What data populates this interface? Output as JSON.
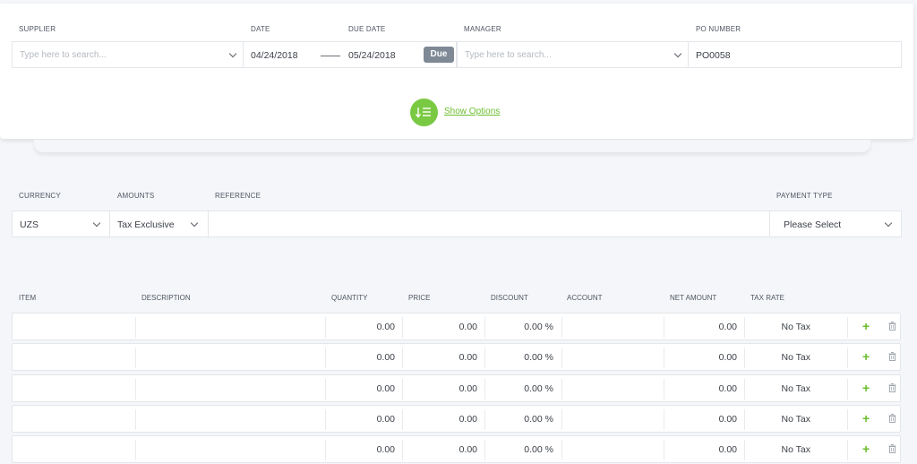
{
  "header": {
    "supplier_label": "SUPPLIER",
    "supplier_placeholder": "Type here to search...",
    "date_label": "DATE",
    "date_value": "04/24/2018",
    "due_date_label": "DUE DATE",
    "due_date_value": "05/24/2018",
    "due_badge": "Due",
    "manager_label": "MANAGER",
    "manager_placeholder": "Type here to search...",
    "po_label": "PO NUMBER",
    "po_value": "PO0058",
    "show_options": "Show Options"
  },
  "settings": {
    "currency_label": "CURRENCY",
    "currency_value": "UZS",
    "amounts_label": "AMOUNTS",
    "amounts_value": "Tax Exclusive",
    "reference_label": "REFERENCE",
    "reference_value": "",
    "payment_type_label": "PAYMENT TYPE",
    "payment_type_value": "Please Select"
  },
  "table": {
    "columns": {
      "item": "ITEM",
      "description": "DESCRIPTION",
      "quantity": "QUANTITY",
      "price": "PRICE",
      "discount": "DISCOUNT",
      "account": "ACCOUNT",
      "net_amount": "NET AMOUNT",
      "tax_rate": "TAX RATE"
    },
    "rows": [
      {
        "quantity": "0.00",
        "price": "0.00",
        "discount": "0.00 %",
        "net_amount": "0.00",
        "tax_rate": "No Tax"
      },
      {
        "quantity": "0.00",
        "price": "0.00",
        "discount": "0.00 %",
        "net_amount": "0.00",
        "tax_rate": "No Tax"
      },
      {
        "quantity": "0.00",
        "price": "0.00",
        "discount": "0.00 %",
        "net_amount": "0.00",
        "tax_rate": "No Tax"
      },
      {
        "quantity": "0.00",
        "price": "0.00",
        "discount": "0.00 %",
        "net_amount": "0.00",
        "tax_rate": "No Tax"
      },
      {
        "quantity": "0.00",
        "price": "0.00",
        "discount": "0.00 %",
        "net_amount": "0.00",
        "tax_rate": "No Tax"
      }
    ],
    "add_glyph": "+"
  },
  "colors": {
    "accent": "#7ac943",
    "link": "#6bbd2e",
    "badge": "#7f8895"
  },
  "icons": {
    "dropdown": "chevron-down-icon",
    "options": "sort-list-icon",
    "add": "plus-icon",
    "delete": "trash-icon"
  }
}
